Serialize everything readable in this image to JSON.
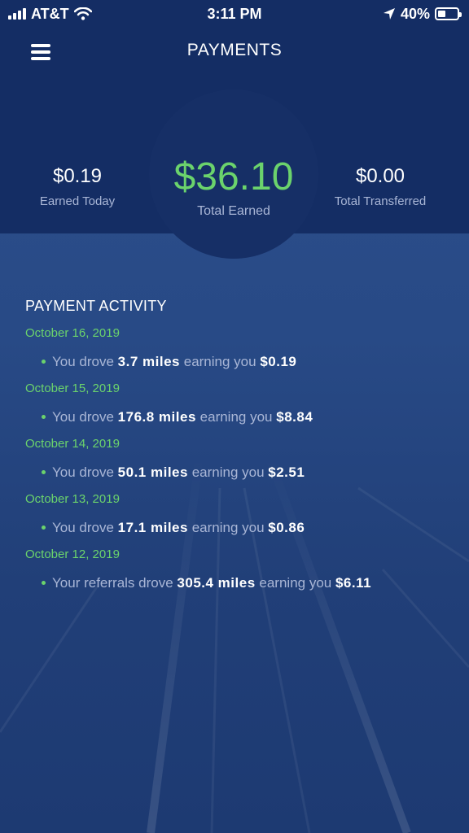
{
  "status_bar": {
    "carrier": "AT&T",
    "time": "3:11 PM",
    "battery_percent": "40%",
    "battery_level": 0.4
  },
  "header": {
    "title": "PAYMENTS"
  },
  "stats": {
    "earned_today": {
      "value": "$0.19",
      "label": "Earned Today"
    },
    "total_earned": {
      "value": "$36.10",
      "label": "Total Earned"
    },
    "total_transferred": {
      "value": "$0.00",
      "label": "Total Transferred"
    }
  },
  "activity": {
    "title": "PAYMENT ACTIVITY",
    "days": [
      {
        "date": "October 16, 2019",
        "prefix": "You drove",
        "miles": "3.7 miles",
        "mid": "earning you",
        "amount": "$0.19"
      },
      {
        "date": "October 15, 2019",
        "prefix": "You drove",
        "miles": "176.8 miles",
        "mid": "earning you",
        "amount": "$8.84"
      },
      {
        "date": "October 14, 2019",
        "prefix": "You drove",
        "miles": "50.1 miles",
        "mid": "earning you",
        "amount": "$2.51"
      },
      {
        "date": "October 13, 2019",
        "prefix": "You drove",
        "miles": "17.1 miles",
        "mid": "earning you",
        "amount": "$0.86"
      },
      {
        "date": "October 12, 2019",
        "prefix": "Your referrals drove",
        "miles": "305.4 miles",
        "mid": "earning you",
        "amount": "$6.11"
      }
    ]
  },
  "colors": {
    "header_bg": "#142d64",
    "accent_green": "#6bd36c",
    "muted_text": "#a9b6d6"
  }
}
